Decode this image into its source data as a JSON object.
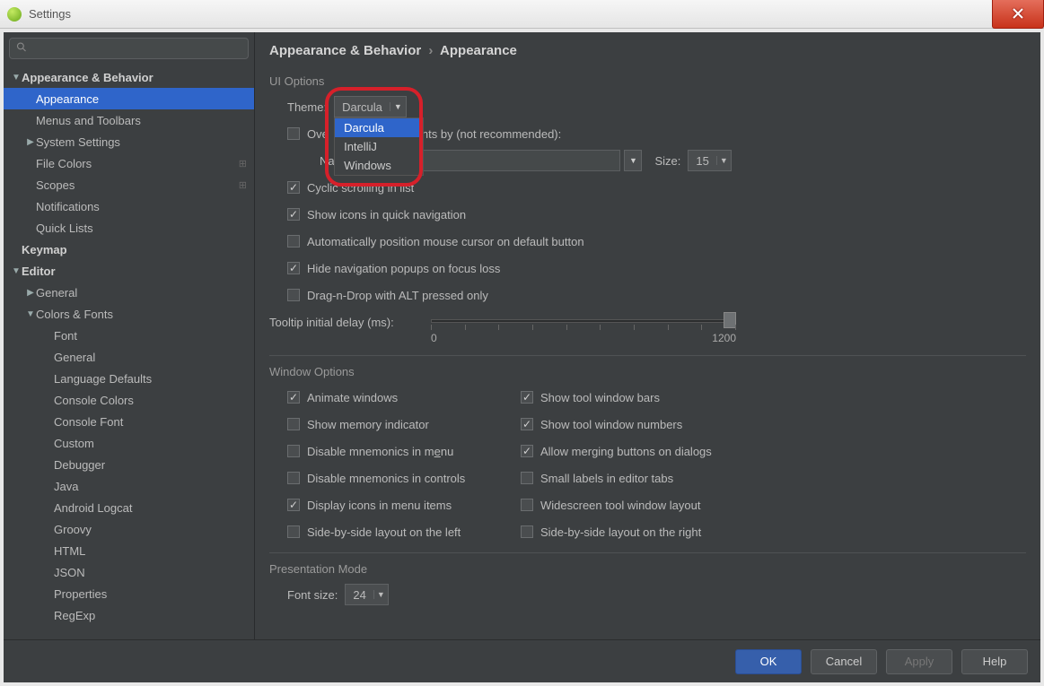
{
  "window": {
    "title": "Settings"
  },
  "sidebar": {
    "search_placeholder": "",
    "items": [
      {
        "label": "Appearance & Behavior",
        "bold": true,
        "expanded": true,
        "indent": 0
      },
      {
        "label": "Appearance",
        "selected": true,
        "indent": 1
      },
      {
        "label": "Menus and Toolbars",
        "indent": 1
      },
      {
        "label": "System Settings",
        "hasChildren": true,
        "indent": 1
      },
      {
        "label": "File Colors",
        "indent": 1,
        "badge": true
      },
      {
        "label": "Scopes",
        "indent": 1,
        "badge": true
      },
      {
        "label": "Notifications",
        "indent": 1
      },
      {
        "label": "Quick Lists",
        "indent": 1
      },
      {
        "label": "Keymap",
        "bold": true,
        "indent": 0
      },
      {
        "label": "Editor",
        "bold": true,
        "expanded": true,
        "indent": 0
      },
      {
        "label": "General",
        "hasChildren": true,
        "indent": 1
      },
      {
        "label": "Colors & Fonts",
        "expanded": true,
        "hasChildren": true,
        "indent": 1
      },
      {
        "label": "Font",
        "indent": 2
      },
      {
        "label": "General",
        "indent": 2
      },
      {
        "label": "Language Defaults",
        "indent": 2
      },
      {
        "label": "Console Colors",
        "indent": 2
      },
      {
        "label": "Console Font",
        "indent": 2
      },
      {
        "label": "Custom",
        "indent": 2
      },
      {
        "label": "Debugger",
        "indent": 2
      },
      {
        "label": "Java",
        "indent": 2
      },
      {
        "label": "Android Logcat",
        "indent": 2
      },
      {
        "label": "Groovy",
        "indent": 2
      },
      {
        "label": "HTML",
        "indent": 2
      },
      {
        "label": "JSON",
        "indent": 2
      },
      {
        "label": "Properties",
        "indent": 2
      },
      {
        "label": "RegExp",
        "indent": 2
      }
    ]
  },
  "breadcrumb": {
    "a": "Appearance & Behavior",
    "b": "Appearance"
  },
  "ui_options": {
    "section": "UI Options",
    "theme_label": "Theme:",
    "theme_value": "Darcula",
    "theme_options": [
      "Darcula",
      "IntelliJ",
      "Windows"
    ],
    "override_label_prefix": "Ove",
    "override_label_suffix": "nts by (not recommended):",
    "name_label": "Nam",
    "size_label": "Size:",
    "size_value": "15",
    "checks": [
      {
        "label": "Cyclic scrolling in list",
        "checked": true
      },
      {
        "label": "Show icons in quick navigation",
        "checked": true
      },
      {
        "label": "Automatically position mouse cursor on default button",
        "checked": false
      },
      {
        "label": "Hide navigation popups on focus loss",
        "checked": true
      },
      {
        "label": "Drag-n-Drop with ALT pressed only",
        "checked": false
      }
    ],
    "tooltip_label": "Tooltip initial delay (ms):",
    "tooltip_min": "0",
    "tooltip_max": "1200"
  },
  "window_options": {
    "section": "Window Options",
    "left": [
      {
        "label": "Animate windows",
        "checked": true
      },
      {
        "label": "Show memory indicator",
        "checked": false
      },
      {
        "label_html": "Disable mnemonics in m<span class='u'>e</span>nu",
        "checked": false
      },
      {
        "label": "Disable mnemonics in controls",
        "checked": false
      },
      {
        "label": "Display icons in menu items",
        "checked": true
      },
      {
        "label": "Side-by-side layout on the left",
        "checked": false
      }
    ],
    "right": [
      {
        "label": "Show tool window bars",
        "checked": true
      },
      {
        "label": "Show tool window numbers",
        "checked": true
      },
      {
        "label": "Allow merging buttons on dialogs",
        "checked": true
      },
      {
        "label": "Small labels in editor tabs",
        "checked": false
      },
      {
        "label": "Widescreen tool window layout",
        "checked": false
      },
      {
        "label": "Side-by-side layout on the right",
        "checked": false
      }
    ]
  },
  "presentation": {
    "section": "Presentation Mode",
    "font_label": "Font size:",
    "font_value": "24"
  },
  "buttons": {
    "ok": "OK",
    "cancel": "Cancel",
    "apply": "Apply",
    "help": "Help"
  }
}
